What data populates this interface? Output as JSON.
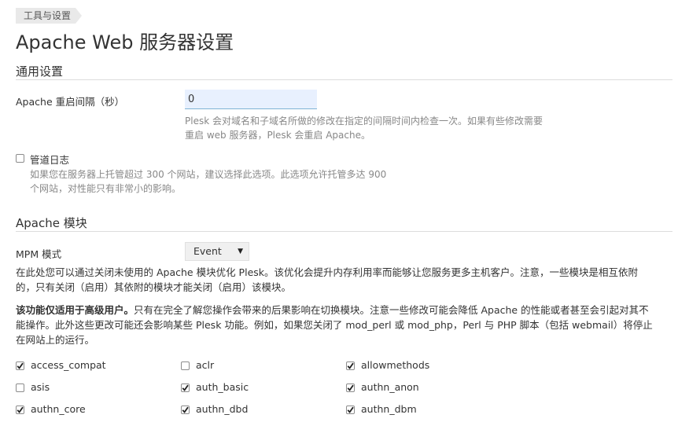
{
  "breadcrumb": "工具与设置",
  "page_title": "Apache Web 服务器设置",
  "general": {
    "heading": "通用设置",
    "restart_label": "Apache 重启间隔（秒）",
    "restart_value": "0",
    "restart_hint_line1": "Plesk 会对域名和子域名所做的修改在指定的间隔时间内检查一次。如果有些修改需要",
    "restart_hint_line2": "重启 web 服务器，Plesk 会重启 Apache。",
    "piped_logs_label": "管道日志",
    "piped_logs_checked": false,
    "piped_logs_hint_line1": "如果您在服务器上托管超过 300 个网站，建议选择此选项。此选项允许托管多达 900",
    "piped_logs_hint_line2": "个网站，对性能只有非常小的影响。"
  },
  "modules": {
    "heading": "Apache 模块",
    "mpm_label": "MPM 模式",
    "mpm_value": "Event",
    "desc_line1": "在此处您可以通过关闭未使用的 Apache 模块优化 Plesk。该优化会提升内存利用率而能够让您服务更多主机客户。注意，一些模块是相互依附",
    "desc_line2": "的，只有关闭（启用）其依附的模块才能关闭（启用）该模块。",
    "warn_bold": "该功能仅适用于高级用户。",
    "warn_line1": "只有在完全了解您操作会带来的后果影响在切换模块。注意一些修改可能会降低 Apache 的性能或者甚至会引起对其不",
    "warn_line2": "能操作。此外这些更改可能还会影响某些 Plesk 功能。例如，如果您关闭了 mod_perl 或 mod_php，Perl 与 PHP 脚本（包括 webmail）将停止",
    "warn_line3": "在网站上的运行。",
    "items": [
      {
        "name": "access_compat",
        "checked": true
      },
      {
        "name": "aclr",
        "checked": false
      },
      {
        "name": "allowmethods",
        "checked": true
      },
      {
        "name": "asis",
        "checked": false
      },
      {
        "name": "auth_basic",
        "checked": true
      },
      {
        "name": "authn_anon",
        "checked": true
      },
      {
        "name": "authn_core",
        "checked": true
      },
      {
        "name": "authn_dbd",
        "checked": true
      },
      {
        "name": "authn_dbm",
        "checked": true
      }
    ]
  },
  "colors": {
    "input_bg": "#e8f0fe",
    "input_border": "#7fb3d5",
    "hint_text": "#888888",
    "rule": "#dddddd"
  }
}
